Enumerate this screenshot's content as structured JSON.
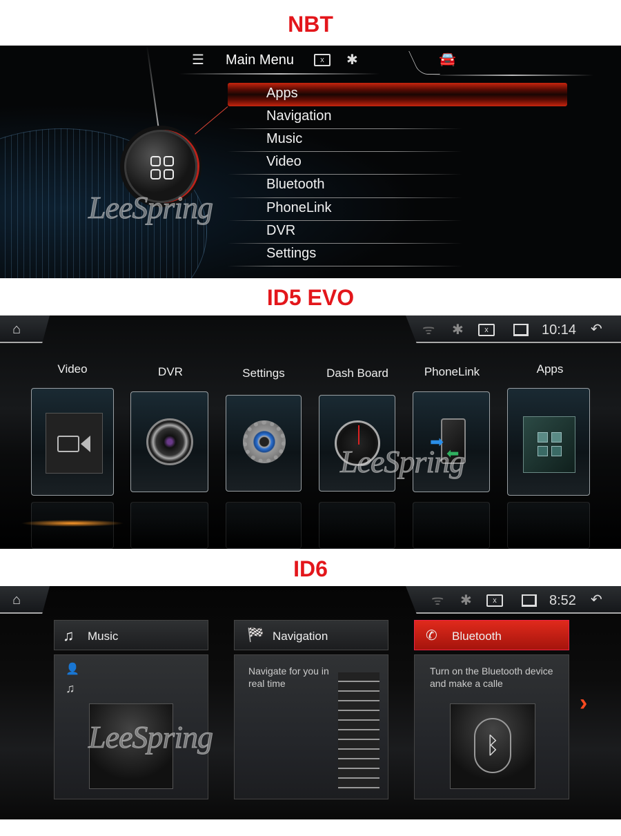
{
  "sections": [
    {
      "title": "NBT"
    },
    {
      "title": "ID5 EVO"
    },
    {
      "title": "ID6"
    }
  ],
  "nbt": {
    "header": {
      "title": "Main Menu",
      "icons": [
        "menu-list-icon",
        "close-box-icon",
        "bluetooth-icon",
        "car-icon"
      ]
    },
    "selected": "Apps",
    "items": [
      "Apps",
      "Navigation",
      "Music",
      "Video",
      "Bluetooth",
      "PhoneLink",
      "DVR",
      "Settings"
    ],
    "watermark": "LeeSpring",
    "accent": "#c8250e"
  },
  "id5": {
    "status": {
      "time": "10:14",
      "icons": [
        "home-icon",
        "wifi-icon",
        "bluetooth-icon",
        "close-box-icon",
        "window-icon",
        "back-icon"
      ]
    },
    "tiles": [
      {
        "label": "Video",
        "icon": "video-camera-icon"
      },
      {
        "label": "DVR",
        "icon": "camera-lens-icon"
      },
      {
        "label": "Settings",
        "icon": "gear-icon"
      },
      {
        "label": "Dash Board",
        "icon": "speedometer-icon"
      },
      {
        "label": "PhoneLink",
        "icon": "phone-link-icon"
      },
      {
        "label": "Apps",
        "icon": "apps-grid-icon"
      }
    ],
    "watermark": "LeeSpring"
  },
  "id6": {
    "status": {
      "time": "8:52"
    },
    "cards": [
      {
        "title": "Music",
        "icon": "music-note-icon",
        "text": ""
      },
      {
        "title": "Navigation",
        "icon": "checkered-flag-icon",
        "text": "Navigate for you in real time"
      },
      {
        "title": "Bluetooth",
        "icon": "phone-icon",
        "text": "Turn on the Bluetooth device and make a calle",
        "active": true
      }
    ],
    "accent": "#d42316",
    "watermark": "LeeSpring"
  },
  "title_color": "#e3161b"
}
